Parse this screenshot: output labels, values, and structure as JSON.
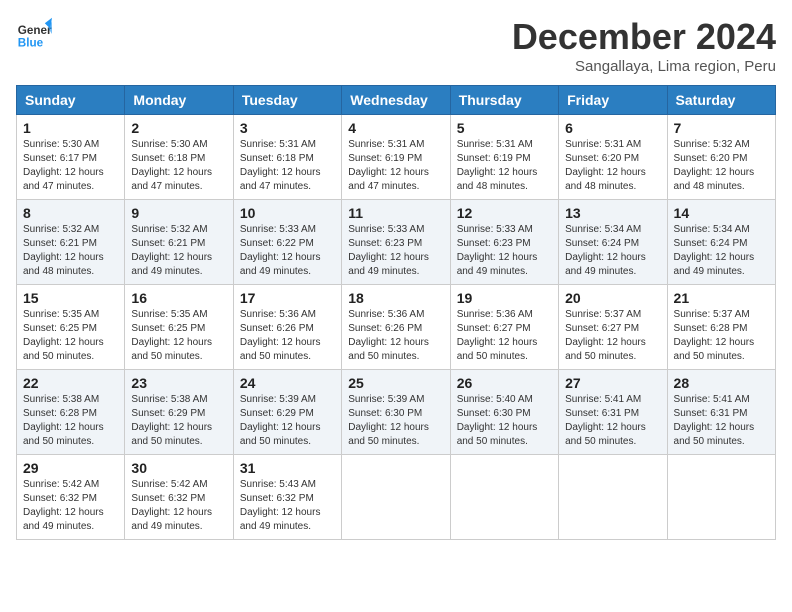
{
  "header": {
    "logo_line1": "General",
    "logo_line2": "Blue",
    "title": "December 2024",
    "subtitle": "Sangallaya, Lima region, Peru"
  },
  "days_of_week": [
    "Sunday",
    "Monday",
    "Tuesday",
    "Wednesday",
    "Thursday",
    "Friday",
    "Saturday"
  ],
  "weeks": [
    [
      {
        "day": "1",
        "info": "Sunrise: 5:30 AM\nSunset: 6:17 PM\nDaylight: 12 hours\nand 47 minutes."
      },
      {
        "day": "2",
        "info": "Sunrise: 5:30 AM\nSunset: 6:18 PM\nDaylight: 12 hours\nand 47 minutes."
      },
      {
        "day": "3",
        "info": "Sunrise: 5:31 AM\nSunset: 6:18 PM\nDaylight: 12 hours\nand 47 minutes."
      },
      {
        "day": "4",
        "info": "Sunrise: 5:31 AM\nSunset: 6:19 PM\nDaylight: 12 hours\nand 47 minutes."
      },
      {
        "day": "5",
        "info": "Sunrise: 5:31 AM\nSunset: 6:19 PM\nDaylight: 12 hours\nand 48 minutes."
      },
      {
        "day": "6",
        "info": "Sunrise: 5:31 AM\nSunset: 6:20 PM\nDaylight: 12 hours\nand 48 minutes."
      },
      {
        "day": "7",
        "info": "Sunrise: 5:32 AM\nSunset: 6:20 PM\nDaylight: 12 hours\nand 48 minutes."
      }
    ],
    [
      {
        "day": "8",
        "info": "Sunrise: 5:32 AM\nSunset: 6:21 PM\nDaylight: 12 hours\nand 48 minutes."
      },
      {
        "day": "9",
        "info": "Sunrise: 5:32 AM\nSunset: 6:21 PM\nDaylight: 12 hours\nand 49 minutes."
      },
      {
        "day": "10",
        "info": "Sunrise: 5:33 AM\nSunset: 6:22 PM\nDaylight: 12 hours\nand 49 minutes."
      },
      {
        "day": "11",
        "info": "Sunrise: 5:33 AM\nSunset: 6:23 PM\nDaylight: 12 hours\nand 49 minutes."
      },
      {
        "day": "12",
        "info": "Sunrise: 5:33 AM\nSunset: 6:23 PM\nDaylight: 12 hours\nand 49 minutes."
      },
      {
        "day": "13",
        "info": "Sunrise: 5:34 AM\nSunset: 6:24 PM\nDaylight: 12 hours\nand 49 minutes."
      },
      {
        "day": "14",
        "info": "Sunrise: 5:34 AM\nSunset: 6:24 PM\nDaylight: 12 hours\nand 49 minutes."
      }
    ],
    [
      {
        "day": "15",
        "info": "Sunrise: 5:35 AM\nSunset: 6:25 PM\nDaylight: 12 hours\nand 50 minutes."
      },
      {
        "day": "16",
        "info": "Sunrise: 5:35 AM\nSunset: 6:25 PM\nDaylight: 12 hours\nand 50 minutes."
      },
      {
        "day": "17",
        "info": "Sunrise: 5:36 AM\nSunset: 6:26 PM\nDaylight: 12 hours\nand 50 minutes."
      },
      {
        "day": "18",
        "info": "Sunrise: 5:36 AM\nSunset: 6:26 PM\nDaylight: 12 hours\nand 50 minutes."
      },
      {
        "day": "19",
        "info": "Sunrise: 5:36 AM\nSunset: 6:27 PM\nDaylight: 12 hours\nand 50 minutes."
      },
      {
        "day": "20",
        "info": "Sunrise: 5:37 AM\nSunset: 6:27 PM\nDaylight: 12 hours\nand 50 minutes."
      },
      {
        "day": "21",
        "info": "Sunrise: 5:37 AM\nSunset: 6:28 PM\nDaylight: 12 hours\nand 50 minutes."
      }
    ],
    [
      {
        "day": "22",
        "info": "Sunrise: 5:38 AM\nSunset: 6:28 PM\nDaylight: 12 hours\nand 50 minutes."
      },
      {
        "day": "23",
        "info": "Sunrise: 5:38 AM\nSunset: 6:29 PM\nDaylight: 12 hours\nand 50 minutes."
      },
      {
        "day": "24",
        "info": "Sunrise: 5:39 AM\nSunset: 6:29 PM\nDaylight: 12 hours\nand 50 minutes."
      },
      {
        "day": "25",
        "info": "Sunrise: 5:39 AM\nSunset: 6:30 PM\nDaylight: 12 hours\nand 50 minutes."
      },
      {
        "day": "26",
        "info": "Sunrise: 5:40 AM\nSunset: 6:30 PM\nDaylight: 12 hours\nand 50 minutes."
      },
      {
        "day": "27",
        "info": "Sunrise: 5:41 AM\nSunset: 6:31 PM\nDaylight: 12 hours\nand 50 minutes."
      },
      {
        "day": "28",
        "info": "Sunrise: 5:41 AM\nSunset: 6:31 PM\nDaylight: 12 hours\nand 50 minutes."
      }
    ],
    [
      {
        "day": "29",
        "info": "Sunrise: 5:42 AM\nSunset: 6:32 PM\nDaylight: 12 hours\nand 49 minutes."
      },
      {
        "day": "30",
        "info": "Sunrise: 5:42 AM\nSunset: 6:32 PM\nDaylight: 12 hours\nand 49 minutes."
      },
      {
        "day": "31",
        "info": "Sunrise: 5:43 AM\nSunset: 6:32 PM\nDaylight: 12 hours\nand 49 minutes."
      },
      {
        "day": "",
        "info": ""
      },
      {
        "day": "",
        "info": ""
      },
      {
        "day": "",
        "info": ""
      },
      {
        "day": "",
        "info": ""
      }
    ]
  ]
}
